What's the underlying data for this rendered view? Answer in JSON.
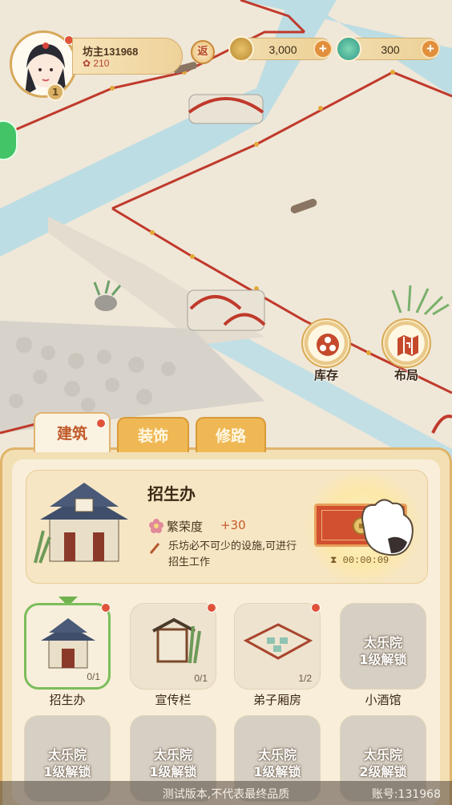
{
  "player": {
    "name": "坊主131968",
    "prosperity": "210",
    "level_badge": "1"
  },
  "hud": {
    "return_label": "返",
    "resources": [
      {
        "name": "copper-coin",
        "value": "3,000"
      },
      {
        "name": "jade",
        "value": "300"
      }
    ],
    "plus_label": "+"
  },
  "side_buttons": {
    "inventory": "库存",
    "layout": "布局"
  },
  "tabs": [
    "建筑",
    "装饰",
    "修路"
  ],
  "selected_building": {
    "title": "招生办",
    "attr_label": "繁荣度",
    "attr_bonus": "+30",
    "description": "乐坊必不可少的设施,可进行招生工作",
    "build_timer": "00:00:09"
  },
  "building_slots": [
    {
      "label": "招生办",
      "count": "0/1",
      "locked": false,
      "new": true,
      "selected": true
    },
    {
      "label": "宣传栏",
      "count": "0/1",
      "locked": false,
      "new": true
    },
    {
      "label": "弟子厢房",
      "count": "1/2",
      "locked": false,
      "new": true
    },
    {
      "label": "小酒馆",
      "count": "",
      "locked": true,
      "lock_text": "太乐院\n1级解锁"
    },
    {
      "label": "",
      "count": "",
      "locked": true,
      "lock_text": "太乐院\n1级解锁"
    },
    {
      "label": "",
      "count": "",
      "locked": true,
      "lock_text": "太乐院\n1级解锁"
    },
    {
      "label": "",
      "count": "",
      "locked": true,
      "lock_text": "太乐院\n1级解锁"
    },
    {
      "label": "",
      "count": "",
      "locked": true,
      "lock_text": "太乐院\n2级解锁"
    }
  ],
  "footer": {
    "watermark": "测试版本,不代表最终品质",
    "account": "账号:131968"
  },
  "colors": {
    "accent": "#c05a2a",
    "panel": "#f3dfb4",
    "fence": "#c0392b",
    "water": "#b9dbe3"
  }
}
